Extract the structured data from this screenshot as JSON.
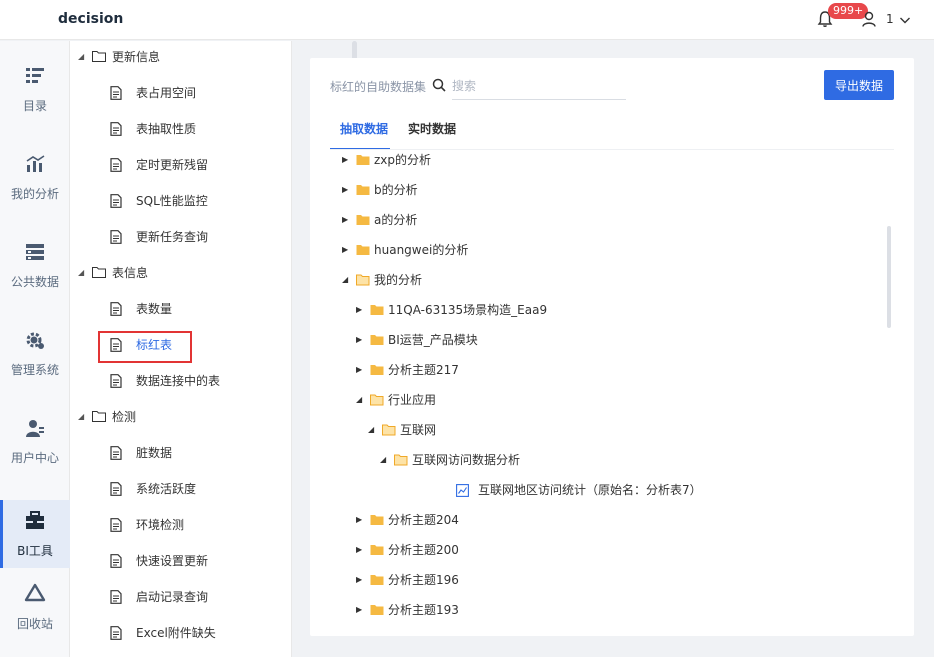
{
  "header": {
    "brand": "decision",
    "badge": "999+",
    "user": "1"
  },
  "leftnav": [
    {
      "label": "目录",
      "icon": "catalog-icon"
    },
    {
      "label": "我的分析",
      "icon": "analysis-icon"
    },
    {
      "label": "公共数据",
      "icon": "public-data-icon"
    },
    {
      "label": "管理系统",
      "icon": "management-gear-icon"
    },
    {
      "label": "用户中心",
      "icon": "user-center-icon"
    },
    {
      "label": "BI工具",
      "icon": "toolbox-icon",
      "active": true
    },
    {
      "label": "回收站",
      "icon": "recycle-bin-icon"
    }
  ],
  "tree": {
    "groups": [
      {
        "label": "更新信息",
        "items": [
          "表占用空间",
          "表抽取性质",
          "定时更新残留",
          "SQL性能监控",
          "更新任务查询"
        ]
      },
      {
        "label": "表信息",
        "items": [
          "表数量",
          "标红表",
          "数据连接中的表"
        ]
      },
      {
        "label": "检测",
        "items": [
          "脏数据",
          "系统活跃度",
          "环境检测",
          "快速设置更新",
          "启动记录查询",
          "Excel附件缺失"
        ]
      }
    ],
    "selected": "标红表"
  },
  "main": {
    "dataset_label": "标红的自助数据集",
    "search_placeholder": "搜索",
    "export_label": "导出数据",
    "tabs": [
      "抽取数据",
      "实时数据"
    ],
    "rows": [
      {
        "label": "zxp的分析",
        "level": 0,
        "expanded": false,
        "type": "folder"
      },
      {
        "label": "b的分析",
        "level": 0,
        "expanded": false,
        "type": "folder"
      },
      {
        "label": "a的分析",
        "level": 0,
        "expanded": false,
        "type": "folder"
      },
      {
        "label": "huangwei的分析",
        "level": 0,
        "expanded": false,
        "type": "folder"
      },
      {
        "label": "我的分析",
        "level": 0,
        "expanded": true,
        "type": "folder"
      },
      {
        "label": "11QA-63135场景构造_Eaa9",
        "level": 1,
        "expanded": false,
        "type": "folder"
      },
      {
        "label": "BI运营_产品模块",
        "level": 1,
        "expanded": false,
        "type": "folder"
      },
      {
        "label": "分析主题217",
        "level": 1,
        "expanded": false,
        "type": "folder"
      },
      {
        "label": "行业应用",
        "level": 1,
        "expanded": true,
        "type": "folder"
      },
      {
        "label": "互联网",
        "level": 2,
        "expanded": true,
        "type": "folder"
      },
      {
        "label": "互联网访问数据分析",
        "level": 3,
        "expanded": true,
        "type": "folder"
      },
      {
        "label": "互联网地区访问统计（原始名：分析表7）",
        "level": 4,
        "type": "report"
      },
      {
        "label": "分析主题204",
        "level": 1,
        "expanded": false,
        "type": "folder"
      },
      {
        "label": "分析主题200",
        "level": 1,
        "expanded": false,
        "type": "folder"
      },
      {
        "label": "分析主题196",
        "level": 1,
        "expanded": false,
        "type": "folder"
      },
      {
        "label": "分析主题193",
        "level": 1,
        "expanded": false,
        "type": "folder"
      }
    ]
  },
  "colors": {
    "accent": "#2f6be3",
    "folder": "#f5b942",
    "highlight_border": "#e23434",
    "badge": "#e8484b"
  }
}
